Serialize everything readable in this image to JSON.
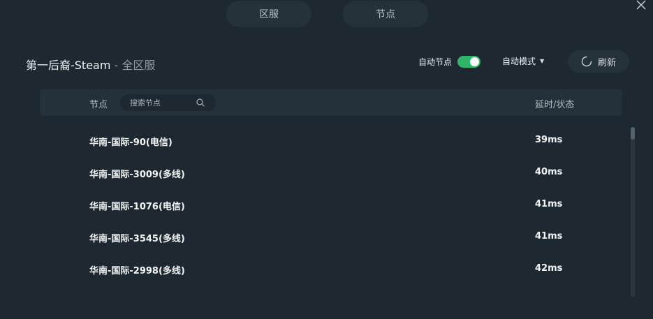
{
  "tabs": [
    {
      "label": "区服"
    },
    {
      "label": "节点"
    }
  ],
  "header": {
    "game": "第一后裔-Steam",
    "separator": " - ",
    "region": "全区服",
    "auto_node_label": "自动节点",
    "auto_node_enabled": true,
    "mode_label": "自动模式",
    "refresh_label": "刷新"
  },
  "table": {
    "col_node": "节点",
    "search_placeholder": "搜索节点",
    "col_latency": "延时/状态",
    "rows": [
      {
        "name": "华南-国际-90(电信)",
        "latency": "39ms"
      },
      {
        "name": "华南-国际-3009(多线)",
        "latency": "40ms"
      },
      {
        "name": "华南-国际-1076(电信)",
        "latency": "41ms"
      },
      {
        "name": "华南-国际-3545(多线)",
        "latency": "41ms"
      },
      {
        "name": "华南-国际-2998(多线)",
        "latency": "42ms"
      }
    ]
  },
  "colors": {
    "background": "#1e2830",
    "panel": "#26323a",
    "toggle_on": "#2fb56a"
  },
  "icons": [
    "close-icon",
    "chevron-down-icon",
    "refresh-icon",
    "search-icon"
  ]
}
